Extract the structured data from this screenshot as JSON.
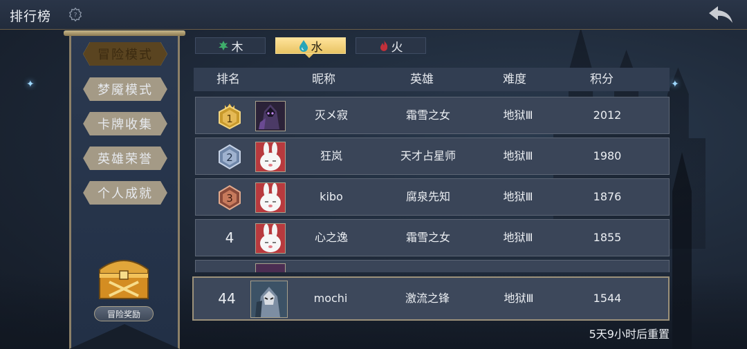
{
  "topbar": {
    "title": "排行榜",
    "help_icon": "question-gear-icon",
    "back_icon": "back-arrow-icon"
  },
  "sidebar": {
    "items": [
      {
        "label": "冒险模式",
        "active": true
      },
      {
        "label": "梦魇模式",
        "active": false
      },
      {
        "label": "卡牌收集",
        "active": false
      },
      {
        "label": "英雄荣誉",
        "active": false
      },
      {
        "label": "个人成就",
        "active": false
      }
    ],
    "reward_label": "冒险奖励",
    "reward_icon": "treasure-chest-icon"
  },
  "tabs": [
    {
      "label": "木",
      "icon": "leaf-icon",
      "color": "#3fae6b",
      "active": false
    },
    {
      "label": "水",
      "icon": "water-drop-icon",
      "color": "#27a5b8",
      "active": true
    },
    {
      "label": "火",
      "icon": "flame-icon",
      "color": "#c2303a",
      "active": false
    }
  ],
  "table": {
    "headers": {
      "rank": "排名",
      "name": "昵称",
      "hero": "英雄",
      "difficulty": "难度",
      "score": "积分"
    },
    "rows": [
      {
        "rank": "1",
        "name": "灭メ寂",
        "hero": "霜雪之女",
        "difficulty": "地狱Ⅲ",
        "score": "2012",
        "medal": "gold-medal-icon",
        "avatar": "dark-knight-avatar"
      },
      {
        "rank": "2",
        "name": "狂岚",
        "hero": "天才占星师",
        "difficulty": "地狱Ⅲ",
        "score": "1980",
        "medal": "silver-medal-icon",
        "avatar": "white-rabbit-avatar"
      },
      {
        "rank": "3",
        "name": "kibo",
        "hero": "腐泉先知",
        "difficulty": "地狱Ⅲ",
        "score": "1876",
        "medal": "bronze-medal-icon",
        "avatar": "white-rabbit-avatar"
      },
      {
        "rank": "4",
        "name": "心之逸",
        "hero": "霜雪之女",
        "difficulty": "地狱Ⅲ",
        "score": "1855",
        "medal": "",
        "avatar": "white-rabbit-avatar"
      }
    ],
    "me": {
      "rank": "44",
      "name": "mochi",
      "hero": "激流之锋",
      "difficulty": "地狱Ⅲ",
      "score": "1544",
      "avatar": "masked-warrior-avatar"
    }
  },
  "reset_text": "5天9小时后重置",
  "colors": {
    "gold": "#e9c464",
    "panel": "#3a4558",
    "background": "#1d2736"
  }
}
